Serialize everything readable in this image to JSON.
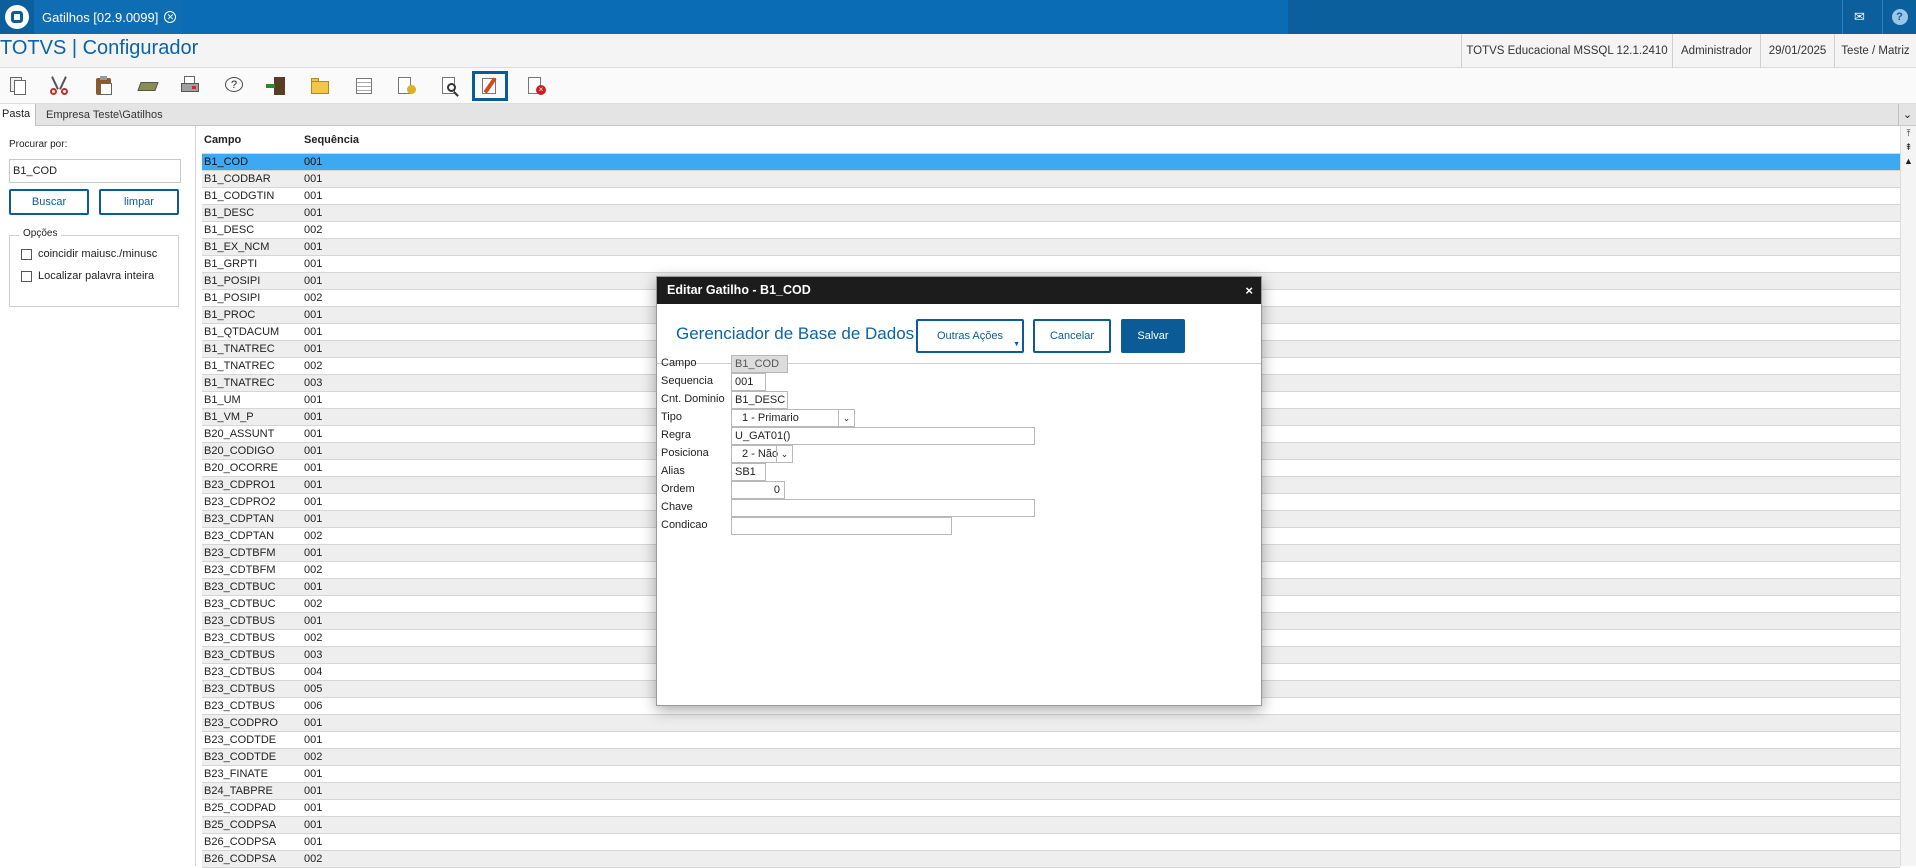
{
  "window": {
    "tab_title": "Gatilhos [02.9.0099]",
    "app_title": "TOTVS | Configurador",
    "environment": "TOTVS Educacional MSSQL 12.1.2410",
    "user": "Administrador",
    "date": "29/01/2025",
    "branch": "Teste / Matriz",
    "help_glyph": "?"
  },
  "toolbar_icons": [
    "copy-icon",
    "cut-icon",
    "paste-icon",
    "book-icon",
    "print-icon",
    "help-icon",
    "exit-icon",
    "folder-icon",
    "list-icon",
    "add-icon",
    "search-icon",
    "edit-icon",
    "delete-icon"
  ],
  "pasta": {
    "tab_label": "Pasta",
    "path": "Empresa Teste\\Gatilhos"
  },
  "search": {
    "label": "Procurar por:",
    "value": "B1_COD",
    "buscar_label": "Buscar",
    "limpar_label": "limpar",
    "options_title": "Opções",
    "opt_case": "coincidir maiusc./minusc",
    "opt_whole": "Localizar palavra inteira"
  },
  "grid": {
    "columns": [
      "Campo",
      "Sequência"
    ],
    "rows": [
      [
        "B1_COD",
        "001"
      ],
      [
        "B1_CODBAR",
        "001"
      ],
      [
        "B1_CODGTIN",
        "001"
      ],
      [
        "B1_DESC",
        "001"
      ],
      [
        "B1_DESC",
        "002"
      ],
      [
        "B1_EX_NCM",
        "001"
      ],
      [
        "B1_GRPTI",
        "001"
      ],
      [
        "B1_POSIPI",
        "001"
      ],
      [
        "B1_POSIPI",
        "002"
      ],
      [
        "B1_PROC",
        "001"
      ],
      [
        "B1_QTDACUM",
        "001"
      ],
      [
        "B1_TNATREC",
        "001"
      ],
      [
        "B1_TNATREC",
        "002"
      ],
      [
        "B1_TNATREC",
        "003"
      ],
      [
        "B1_UM",
        "001"
      ],
      [
        "B1_VM_P",
        "001"
      ],
      [
        "B20_ASSUNT",
        "001"
      ],
      [
        "B20_CODIGO",
        "001"
      ],
      [
        "B20_OCORRE",
        "001"
      ],
      [
        "B23_CDPRO1",
        "001"
      ],
      [
        "B23_CDPRO2",
        "001"
      ],
      [
        "B23_CDPTAN",
        "001"
      ],
      [
        "B23_CDPTAN",
        "002"
      ],
      [
        "B23_CDTBFM",
        "001"
      ],
      [
        "B23_CDTBFM",
        "002"
      ],
      [
        "B23_CDTBUC",
        "001"
      ],
      [
        "B23_CDTBUC",
        "002"
      ],
      [
        "B23_CDTBUS",
        "001"
      ],
      [
        "B23_CDTBUS",
        "002"
      ],
      [
        "B23_CDTBUS",
        "003"
      ],
      [
        "B23_CDTBUS",
        "004"
      ],
      [
        "B23_CDTBUS",
        "005"
      ],
      [
        "B23_CDTBUS",
        "006"
      ],
      [
        "B23_CODPRO",
        "001"
      ],
      [
        "B23_CODTDE",
        "001"
      ],
      [
        "B23_CODTDE",
        "002"
      ],
      [
        "B23_FINATE",
        "001"
      ],
      [
        "B24_TABPRE",
        "001"
      ],
      [
        "B25_CODPAD",
        "001"
      ],
      [
        "B25_CODPSA",
        "001"
      ],
      [
        "B26_CODPSA",
        "001"
      ],
      [
        "B26_CODPSA",
        "002"
      ]
    ]
  },
  "dialog": {
    "title": "Editar Gatilho - B1_COD",
    "close_glyph": "×",
    "heading": "Gerenciador de Base de Dados",
    "btn_outras": "Outras Ações",
    "btn_cancelar": "Cancelar",
    "btn_salvar": "Salvar",
    "fields": {
      "campo": {
        "label": "Campo",
        "value": "B1_COD"
      },
      "sequencia": {
        "label": "Sequencia",
        "value": "001"
      },
      "cnt_dominio": {
        "label": "Cnt. Dominio",
        "value": "B1_DESC"
      },
      "tipo": {
        "label": "Tipo",
        "value": "1 - Primario"
      },
      "regra": {
        "label": "Regra",
        "value": "U_GAT01()"
      },
      "posiciona": {
        "label": "Posiciona",
        "value": "2 - Não"
      },
      "alias": {
        "label": "Alias",
        "value": "SB1"
      },
      "ordem": {
        "label": "Ordem",
        "value": "0"
      },
      "chave": {
        "label": "Chave",
        "value": ""
      },
      "condicao": {
        "label": "Condicao",
        "value": ""
      }
    }
  },
  "colors": {
    "brand_blue": "#0a5f9c",
    "selected_row": "#3ea8f0",
    "dialog_header": "#1c1c1c"
  }
}
